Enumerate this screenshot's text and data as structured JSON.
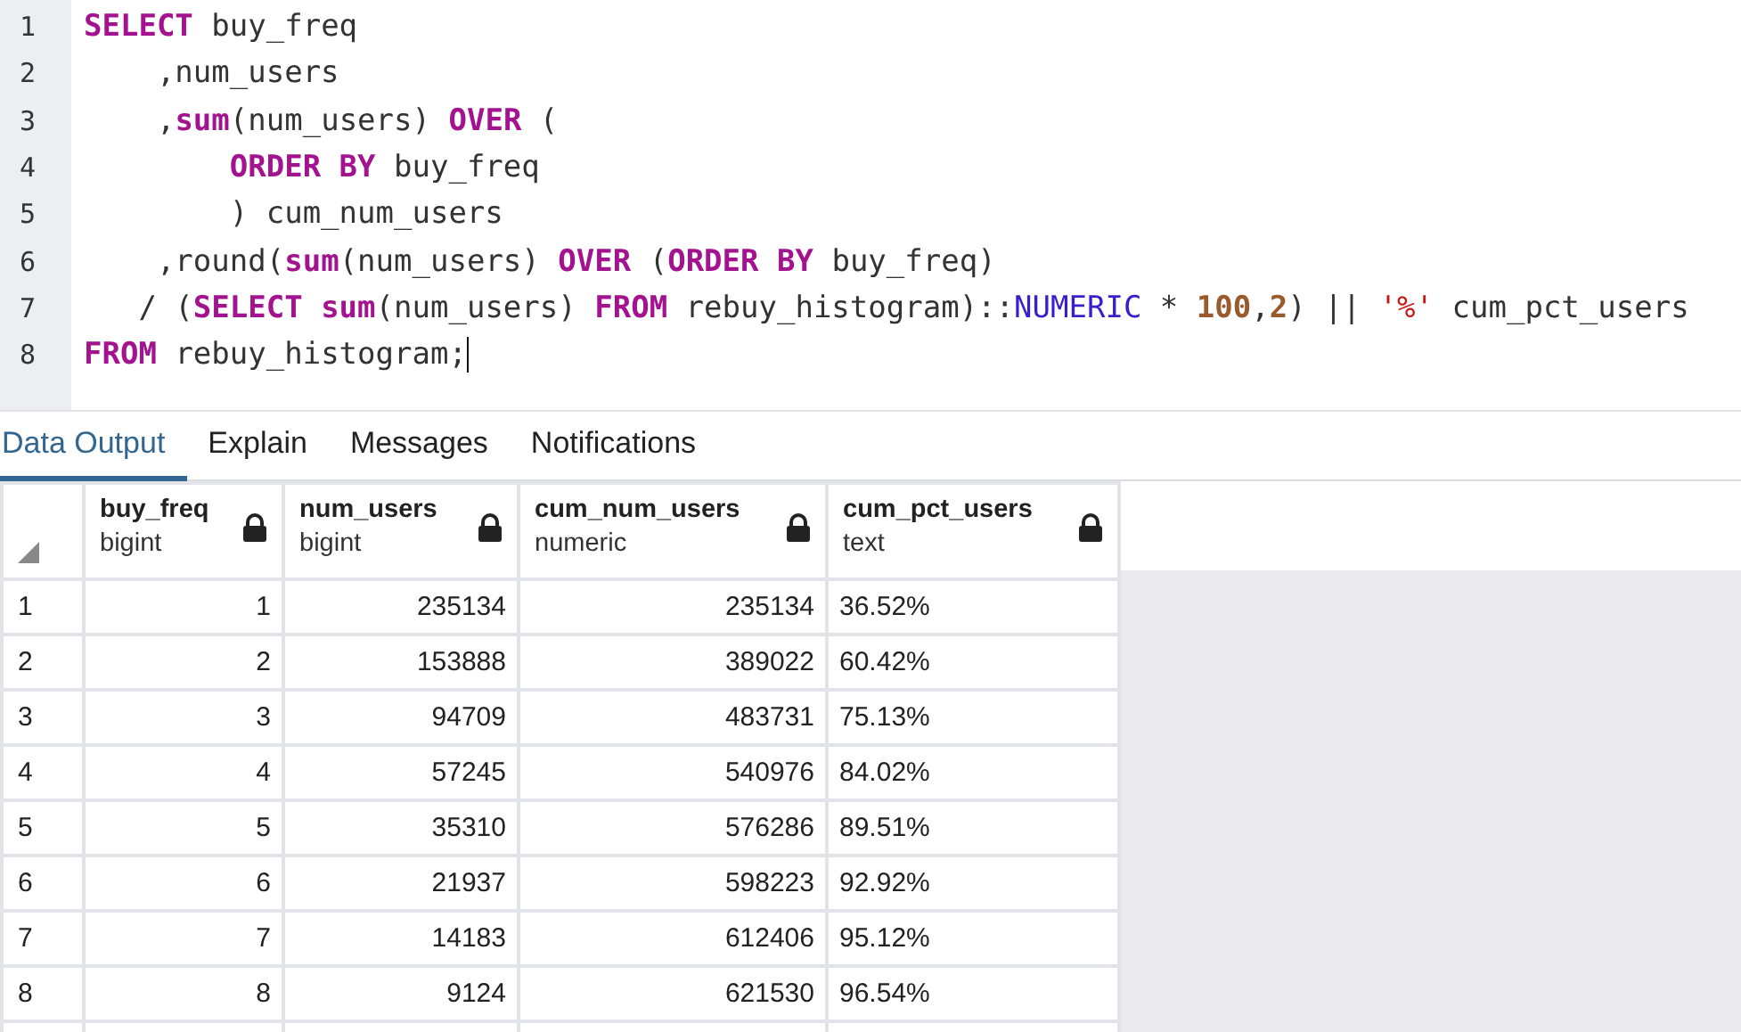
{
  "editor": {
    "lines": [
      {
        "number": "1",
        "tokens": [
          {
            "kind": "keyword",
            "text": "SELECT"
          },
          {
            "kind": "plain",
            "text": " buy_freq"
          }
        ]
      },
      {
        "number": "2",
        "tokens": [
          {
            "kind": "plain",
            "text": "    ,num_users"
          }
        ]
      },
      {
        "number": "3",
        "tokens": [
          {
            "kind": "plain",
            "text": "    ,"
          },
          {
            "kind": "keyword",
            "text": "sum"
          },
          {
            "kind": "plain",
            "text": "(num_users) "
          },
          {
            "kind": "keyword",
            "text": "OVER"
          },
          {
            "kind": "plain",
            "text": " ("
          }
        ]
      },
      {
        "number": "4",
        "tokens": [
          {
            "kind": "keyword",
            "text": "        ORDER BY"
          },
          {
            "kind": "plain",
            "text": " buy_freq"
          }
        ]
      },
      {
        "number": "5",
        "tokens": [
          {
            "kind": "plain",
            "text": "        ) cum_num_users"
          }
        ]
      },
      {
        "number": "6",
        "tokens": [
          {
            "kind": "plain",
            "text": "    ,round("
          },
          {
            "kind": "keyword",
            "text": "sum"
          },
          {
            "kind": "plain",
            "text": "(num_users) "
          },
          {
            "kind": "keyword",
            "text": "OVER"
          },
          {
            "kind": "plain",
            "text": " ("
          },
          {
            "kind": "keyword",
            "text": "ORDER BY"
          },
          {
            "kind": "plain",
            "text": " buy_freq)"
          }
        ]
      },
      {
        "number": "7",
        "tokens": [
          {
            "kind": "plain",
            "text": "   / ("
          },
          {
            "kind": "keyword",
            "text": "SELECT sum"
          },
          {
            "kind": "plain",
            "text": "(num_users) "
          },
          {
            "kind": "keyword",
            "text": "FROM"
          },
          {
            "kind": "plain",
            "text": " rebuy_histogram)::"
          },
          {
            "kind": "type",
            "text": "NUMERIC"
          },
          {
            "kind": "plain",
            "text": " * "
          },
          {
            "kind": "number",
            "text": "100"
          },
          {
            "kind": "plain",
            "text": ","
          },
          {
            "kind": "number",
            "text": "2"
          },
          {
            "kind": "plain",
            "text": ") || "
          },
          {
            "kind": "string",
            "text": "'%'"
          },
          {
            "kind": "plain",
            "text": " cum_pct_users"
          }
        ]
      },
      {
        "number": "8",
        "cursor": true,
        "tokens": [
          {
            "kind": "keyword",
            "text": "FROM"
          },
          {
            "kind": "plain",
            "text": " rebuy_histogram;"
          }
        ]
      }
    ]
  },
  "tabs": [
    {
      "label": "Data Output",
      "selected": true
    },
    {
      "label": "Explain",
      "selected": false
    },
    {
      "label": "Messages",
      "selected": false
    },
    {
      "label": "Notifications",
      "selected": false
    }
  ],
  "table": {
    "columns": [
      {
        "name": "buy_freq",
        "type": "bigint"
      },
      {
        "name": "num_users",
        "type": "bigint"
      },
      {
        "name": "cum_num_users",
        "type": "numeric"
      },
      {
        "name": "cum_pct_users",
        "type": "text"
      }
    ],
    "rows": [
      {
        "number": "1",
        "cells": [
          "1",
          "235134",
          "235134",
          "36.52%"
        ]
      },
      {
        "number": "2",
        "cells": [
          "2",
          "153888",
          "389022",
          "60.42%"
        ]
      },
      {
        "number": "3",
        "cells": [
          "3",
          "94709",
          "483731",
          "75.13%"
        ]
      },
      {
        "number": "4",
        "cells": [
          "4",
          "57245",
          "540976",
          "84.02%"
        ]
      },
      {
        "number": "5",
        "cells": [
          "5",
          "35310",
          "576286",
          "89.51%"
        ]
      },
      {
        "number": "6",
        "cells": [
          "6",
          "21937",
          "598223",
          "92.92%"
        ]
      },
      {
        "number": "7",
        "cells": [
          "7",
          "14183",
          "612406",
          "95.12%"
        ]
      },
      {
        "number": "8",
        "cells": [
          "8",
          "9124",
          "621530",
          "96.54%"
        ]
      }
    ]
  }
}
